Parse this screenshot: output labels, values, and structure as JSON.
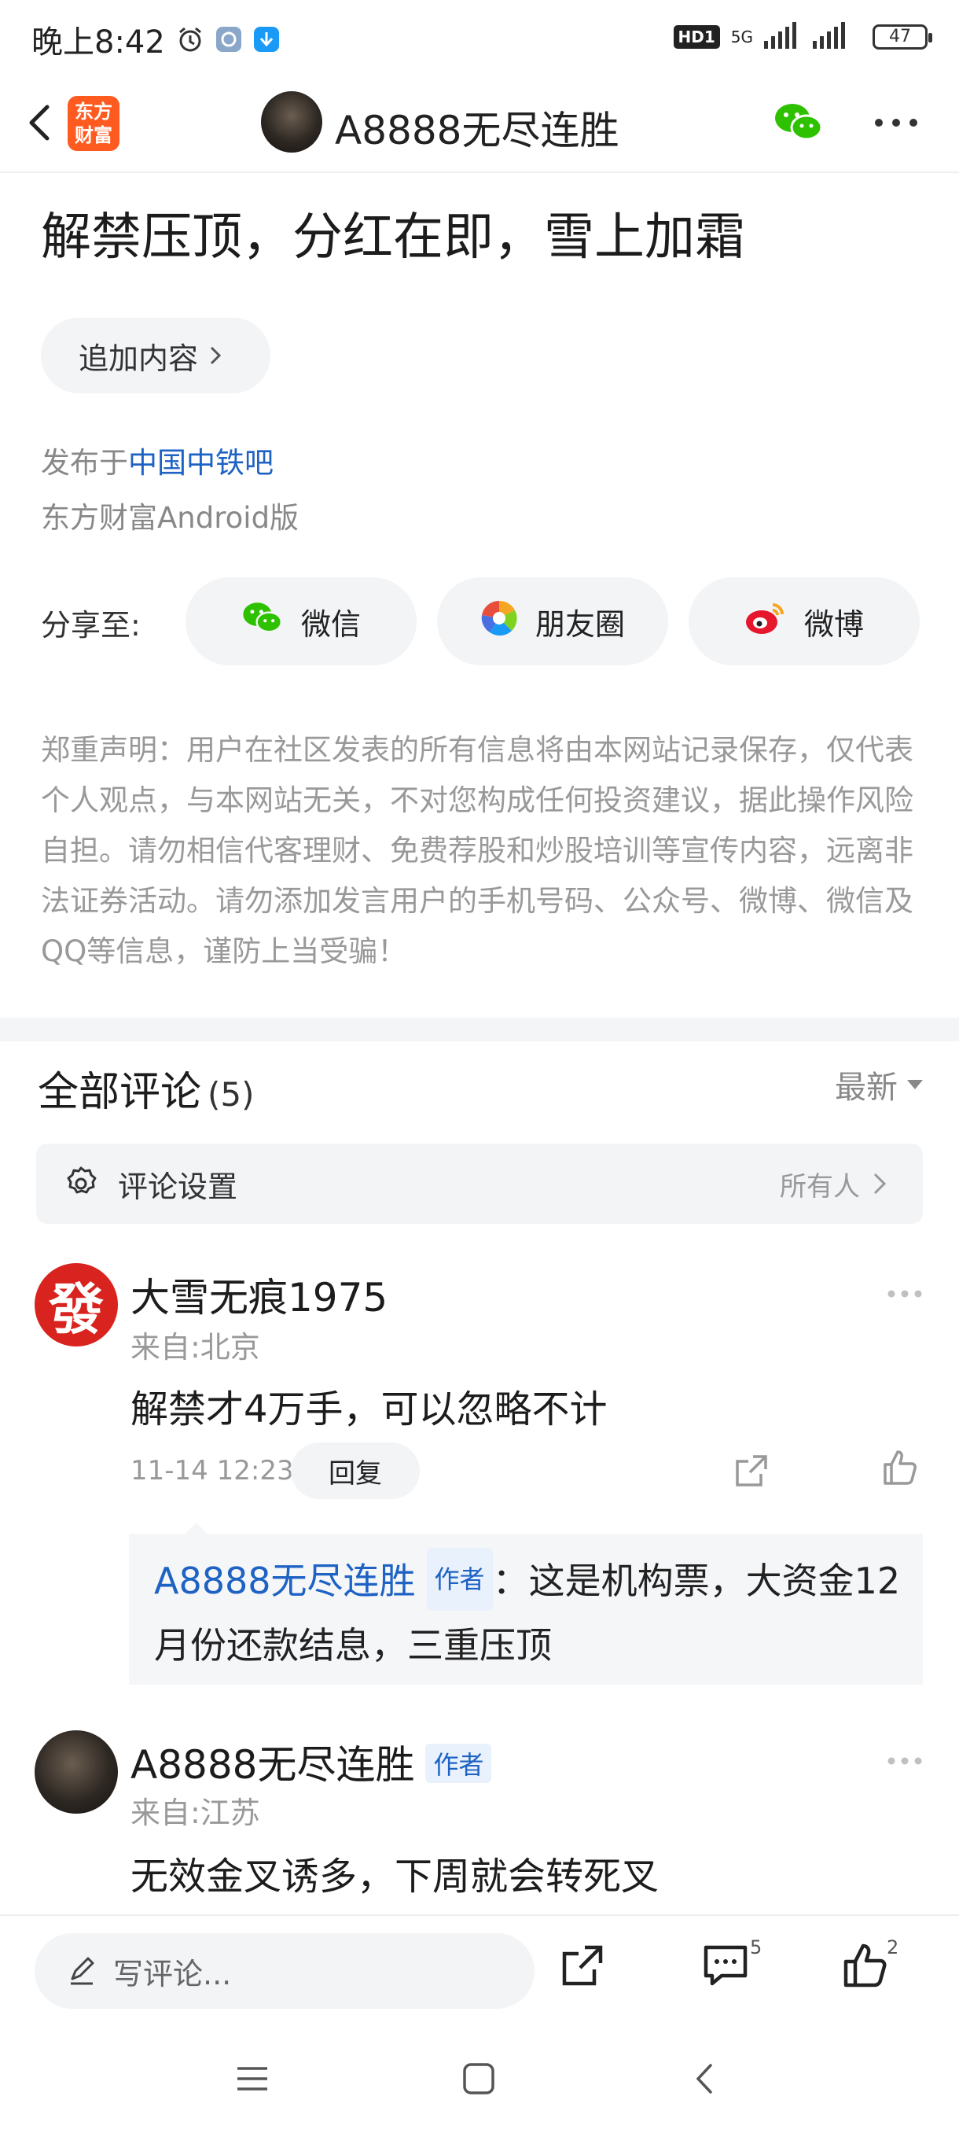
{
  "status_bar": {
    "time": "晚上8:42",
    "hd": "HD1",
    "network": "5G",
    "battery": "47"
  },
  "header": {
    "title": "A8888无尽连胜",
    "logo_text": "东方\n财富"
  },
  "article": {
    "title": "解禁压顶，分红在即，雪上加霜",
    "add_content_label": "追加内容",
    "published_prefix": "发布于",
    "forum": "中国中铁吧",
    "client": "东方财富Android版",
    "share_label": "分享至:",
    "share": {
      "wechat": "微信",
      "moments": "朋友圈",
      "weibo": "微博"
    },
    "disclaimer": "郑重声明：用户在社区发表的所有信息将由本网站记录保存，仅代表个人观点，与本网站无关，不对您构成任何投资建议，据此操作风险自担。请勿相信代客理财、免费荐股和炒股培训等宣传内容，远离非法证券活动。请勿添加发言用户的手机号码、公众号、微博、微信及QQ等信息，谨防上当受骗！"
  },
  "comments": {
    "title": "全部评论",
    "count": "(5)",
    "sort": "最新",
    "settings_label": "评论设置",
    "settings_scope": "所有人",
    "items": [
      {
        "avatar_char": "發",
        "name": "大雪无痕1975",
        "location": "来自:北京",
        "text": "解禁才4万手，可以忽略不计",
        "time": "11-14 12:23",
        "reply_label": "回复",
        "sub_reply": {
          "author": "A8888无尽连胜",
          "badge": "作者",
          "text": "：这是机构票，大资金12月份还款结息，三重压顶"
        }
      },
      {
        "name": "A8888无尽连胜",
        "badge": "作者",
        "location": "来自:江苏",
        "text": "无效金叉诱多，下周就会转死叉"
      }
    ]
  },
  "bottom_bar": {
    "write_placeholder": "写评论...",
    "comment_count": "5",
    "like_count": "2"
  },
  "colors": {
    "accent_blue": "#1e62c4",
    "logo_orange": "#ff5a1f",
    "avatar_red": "#d9231f"
  }
}
